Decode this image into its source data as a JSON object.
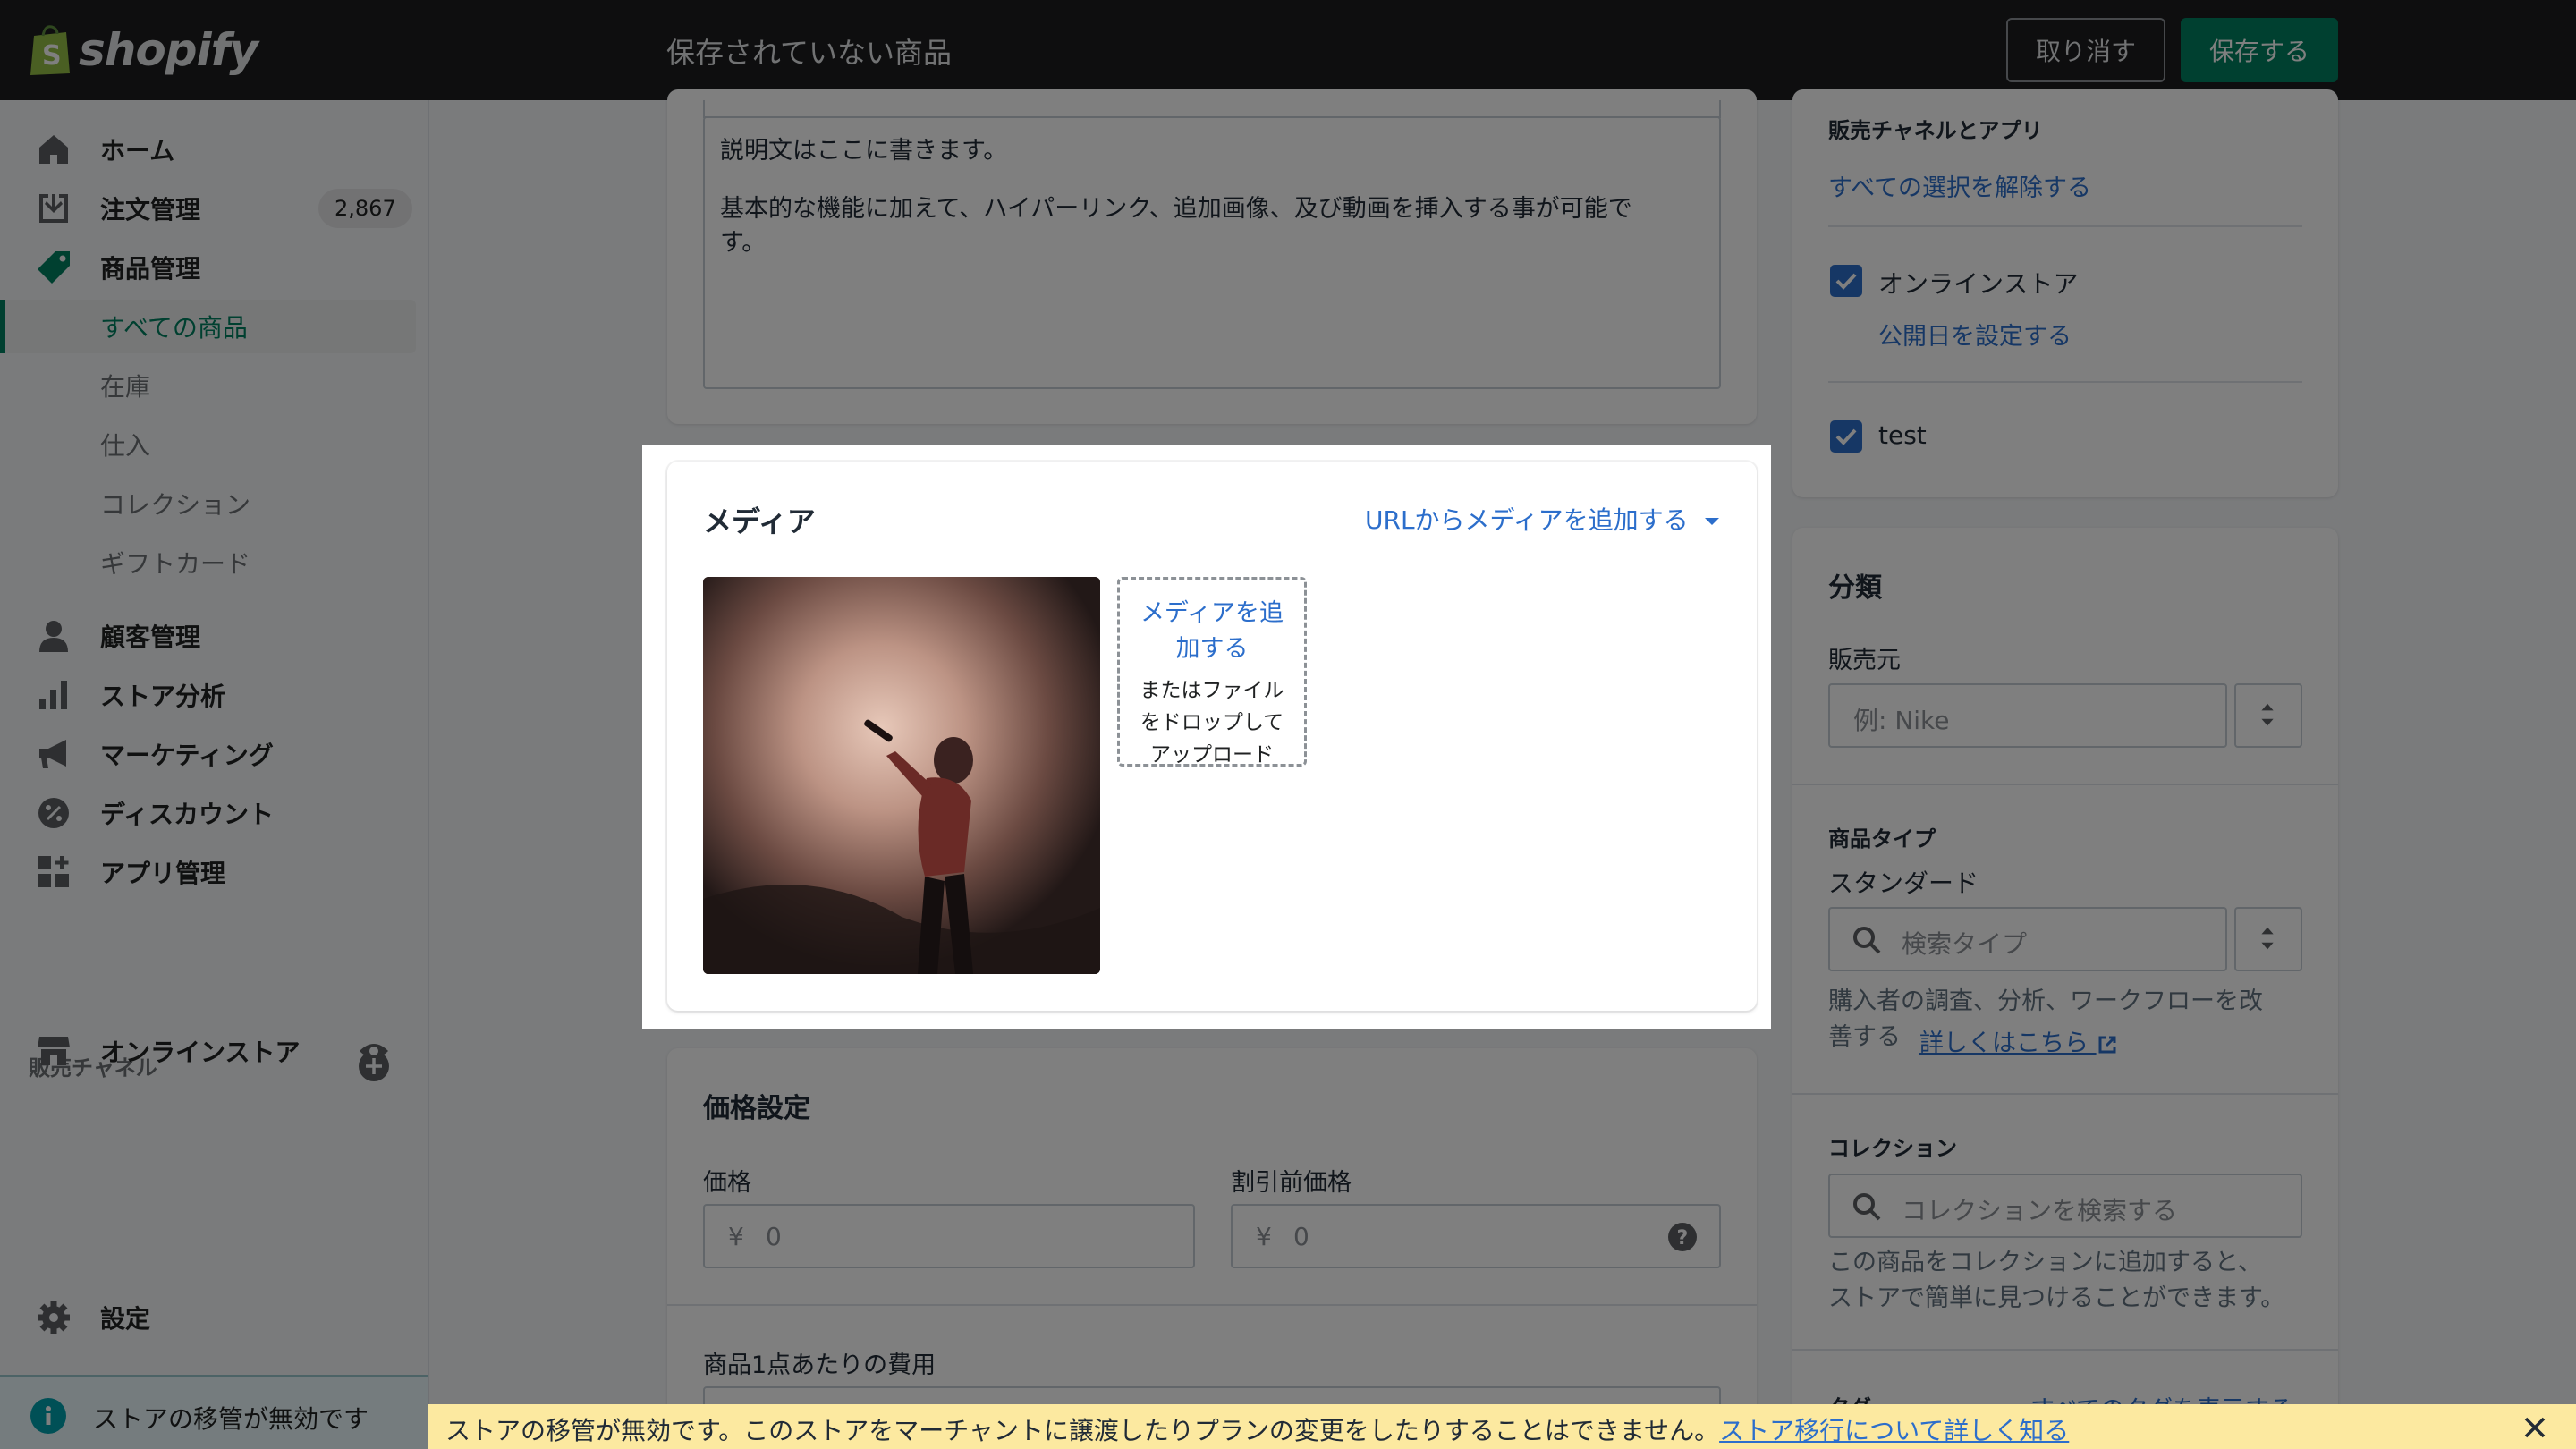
{
  "app": {
    "logo_text": "shopify",
    "page_title": "保存されていない商品",
    "discard_label": "取り消す",
    "save_label": "保存する"
  },
  "sidebar": {
    "items": [
      {
        "label": "ホーム",
        "icon": "home-icon"
      },
      {
        "label": "注文管理",
        "icon": "orders-icon",
        "badge": "2,867"
      },
      {
        "label": "商品管理",
        "icon": "tag-icon"
      }
    ],
    "sub_items": [
      {
        "label": "すべての商品",
        "active": true
      },
      {
        "label": "在庫"
      },
      {
        "label": "仕入"
      },
      {
        "label": "コレクション"
      },
      {
        "label": "ギフトカード"
      }
    ],
    "items2": [
      {
        "label": "顧客管理",
        "icon": "person-icon"
      },
      {
        "label": "ストア分析",
        "icon": "analytics-icon"
      },
      {
        "label": "マーケティング",
        "icon": "megaphone-icon"
      },
      {
        "label": "ディスカウント",
        "icon": "discount-icon"
      },
      {
        "label": "アプリ管理",
        "icon": "apps-icon"
      }
    ],
    "channels_label": "販売チャネル",
    "online_store": "オンラインストア",
    "settings": "設定",
    "footer_notice": "ストアの移管が無効です"
  },
  "description": {
    "line1": "説明文はここに書きます。",
    "line2": "基本的な機能に加えて、ハイパーリンク、追加画像、及び動画を挿入する事が可能で",
    "line3": "す。"
  },
  "media": {
    "title": "メディア",
    "url_link": "URLからメディアを追加する",
    "add_link_1": "メディアを追",
    "add_link_2": "加する",
    "drop_1": "またはファイル",
    "drop_2": "をドロップして",
    "drop_3": "アップロード"
  },
  "pricing": {
    "title": "価格設定",
    "price_label": "価格",
    "compare_label": "割引前価格",
    "currency": "¥",
    "price_placeholder": "0",
    "compare_placeholder": "0",
    "cost_label": "商品1点あたりの費用"
  },
  "channels": {
    "header": "販売チャネルとアプリ",
    "deselect": "すべての選択を解除する",
    "online_store": "オンラインストア",
    "set_date": "公開日を設定する",
    "test": "test"
  },
  "classification": {
    "title": "分類",
    "vendor_label": "販売元",
    "vendor_placeholder": "例: Nike",
    "type_label": "商品タイプ",
    "type_value": "スタンダード",
    "type_placeholder": "検索タイプ",
    "type_help_1": "購入者の調査、分析、ワークフローを改",
    "type_help_2": "善する",
    "learn_more": "詳しくはこちら",
    "collections_label": "コレクション",
    "collections_placeholder": "コレクションを検索する",
    "collections_help_1": "この商品をコレクションに追加すると、",
    "collections_help_2": "ストアで簡単に見つけることができます。",
    "tags_label": "タグ",
    "tags_link": "すべてのタグを表示する"
  },
  "banner": {
    "text": "ストアの移管が無効です。このストアをマーチャントに譲渡したりプランの変更をしたりすることはできません。",
    "link": "ストア移行について詳しく知る"
  },
  "colors": {
    "accent": "#008060",
    "link": "#2c6ecb",
    "topbar": "#1c1d1f"
  }
}
